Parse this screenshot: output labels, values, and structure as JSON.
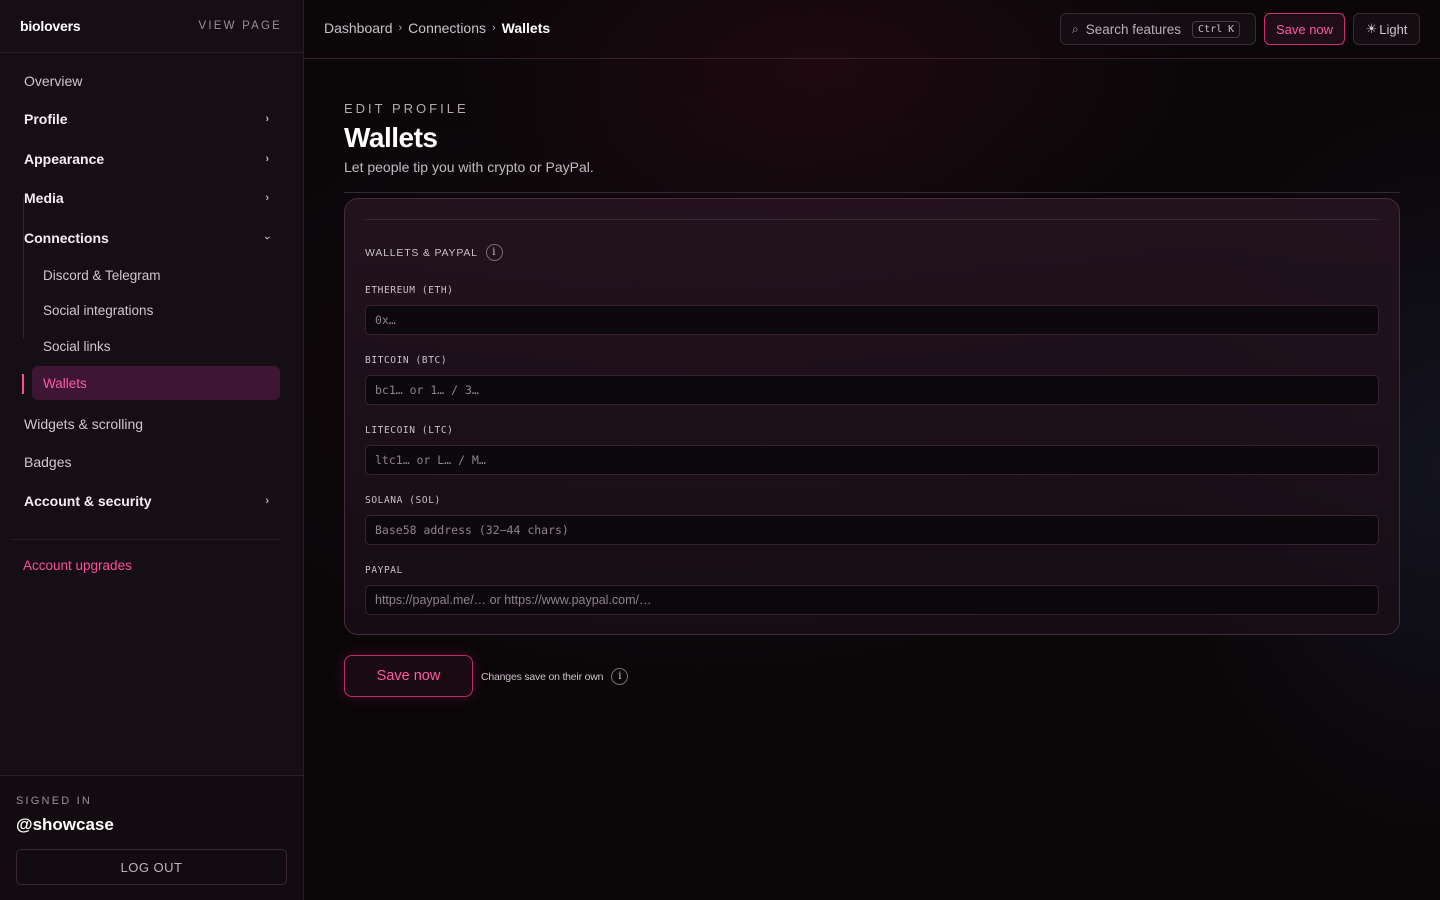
{
  "brand": {
    "name": "biolovers",
    "view_page": "VIEW PAGE"
  },
  "sidebar": {
    "items": [
      {
        "label": "Overview"
      },
      {
        "label": "Profile"
      },
      {
        "label": "Appearance"
      },
      {
        "label": "Media"
      },
      {
        "label": "Connections"
      },
      {
        "label": "Widgets & scrolling"
      },
      {
        "label": "Badges"
      },
      {
        "label": "Account & security"
      }
    ],
    "connections_sub": [
      {
        "label": "Discord & Telegram"
      },
      {
        "label": "Social integrations"
      },
      {
        "label": "Social links"
      },
      {
        "label": "Wallets",
        "active": true
      }
    ],
    "upgrades": "Account upgrades",
    "footer": {
      "signed_in_label": "SIGNED IN",
      "handle": "@showcase",
      "logout": "LOG OUT"
    }
  },
  "header": {
    "breadcrumb": [
      "Dashboard",
      "Connections",
      "Wallets"
    ],
    "search_label": "Search features",
    "search_shortcut": "Ctrl K",
    "save": "Save now",
    "theme": "Light"
  },
  "page": {
    "eyebrow": "EDIT PROFILE",
    "title": "Wallets",
    "subtitle": "Let people tip you with crypto or PayPal."
  },
  "card": {
    "section_label": "WALLETS & PAYPAL",
    "fields": [
      {
        "label": "ETHEREUM (ETH)",
        "placeholder": "0x…",
        "value": ""
      },
      {
        "label": "BITCOIN (BTC)",
        "placeholder": "bc1… or 1… / 3…",
        "value": ""
      },
      {
        "label": "LITECOIN (LTC)",
        "placeholder": "ltc1… or L… / M…",
        "value": ""
      },
      {
        "label": "SOLANA (SOL)",
        "placeholder": "Base58 address (32–44 chars)",
        "value": ""
      },
      {
        "label": "PAYPAL",
        "placeholder": "https://paypal.me/… or https://www.paypal.com/…",
        "value": ""
      }
    ]
  },
  "footer_actions": {
    "save": "Save now",
    "note": "Changes save on their own"
  },
  "colors": {
    "accent": "#ff4f97",
    "background": "#0b0709",
    "sidebar": "#150e14"
  }
}
